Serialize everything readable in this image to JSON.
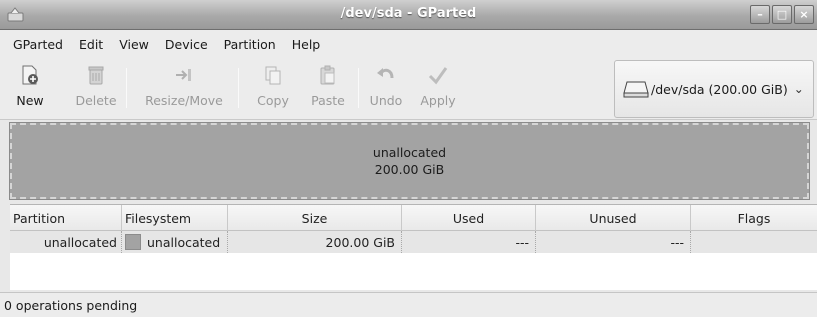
{
  "window": {
    "title": "/dev/sda - GParted"
  },
  "menu": [
    "GParted",
    "Edit",
    "View",
    "Device",
    "Partition",
    "Help"
  ],
  "toolbar": {
    "new": "New",
    "delete": "Delete",
    "resize_move": "Resize/Move",
    "copy": "Copy",
    "paste": "Paste",
    "undo": "Undo",
    "apply": "Apply"
  },
  "device": {
    "label": "/dev/sda  (200.00 GiB)"
  },
  "diskmap": {
    "name": "unallocated",
    "size": "200.00 GiB"
  },
  "table": {
    "headers": [
      "Partition",
      "Filesystem",
      "Size",
      "Used",
      "Unused",
      "Flags"
    ],
    "rows": [
      {
        "partition": "unallocated",
        "filesystem": "unallocated",
        "size": "200.00 GiB",
        "used": "---",
        "unused": "---",
        "flags": ""
      }
    ]
  },
  "status": "0 operations pending"
}
